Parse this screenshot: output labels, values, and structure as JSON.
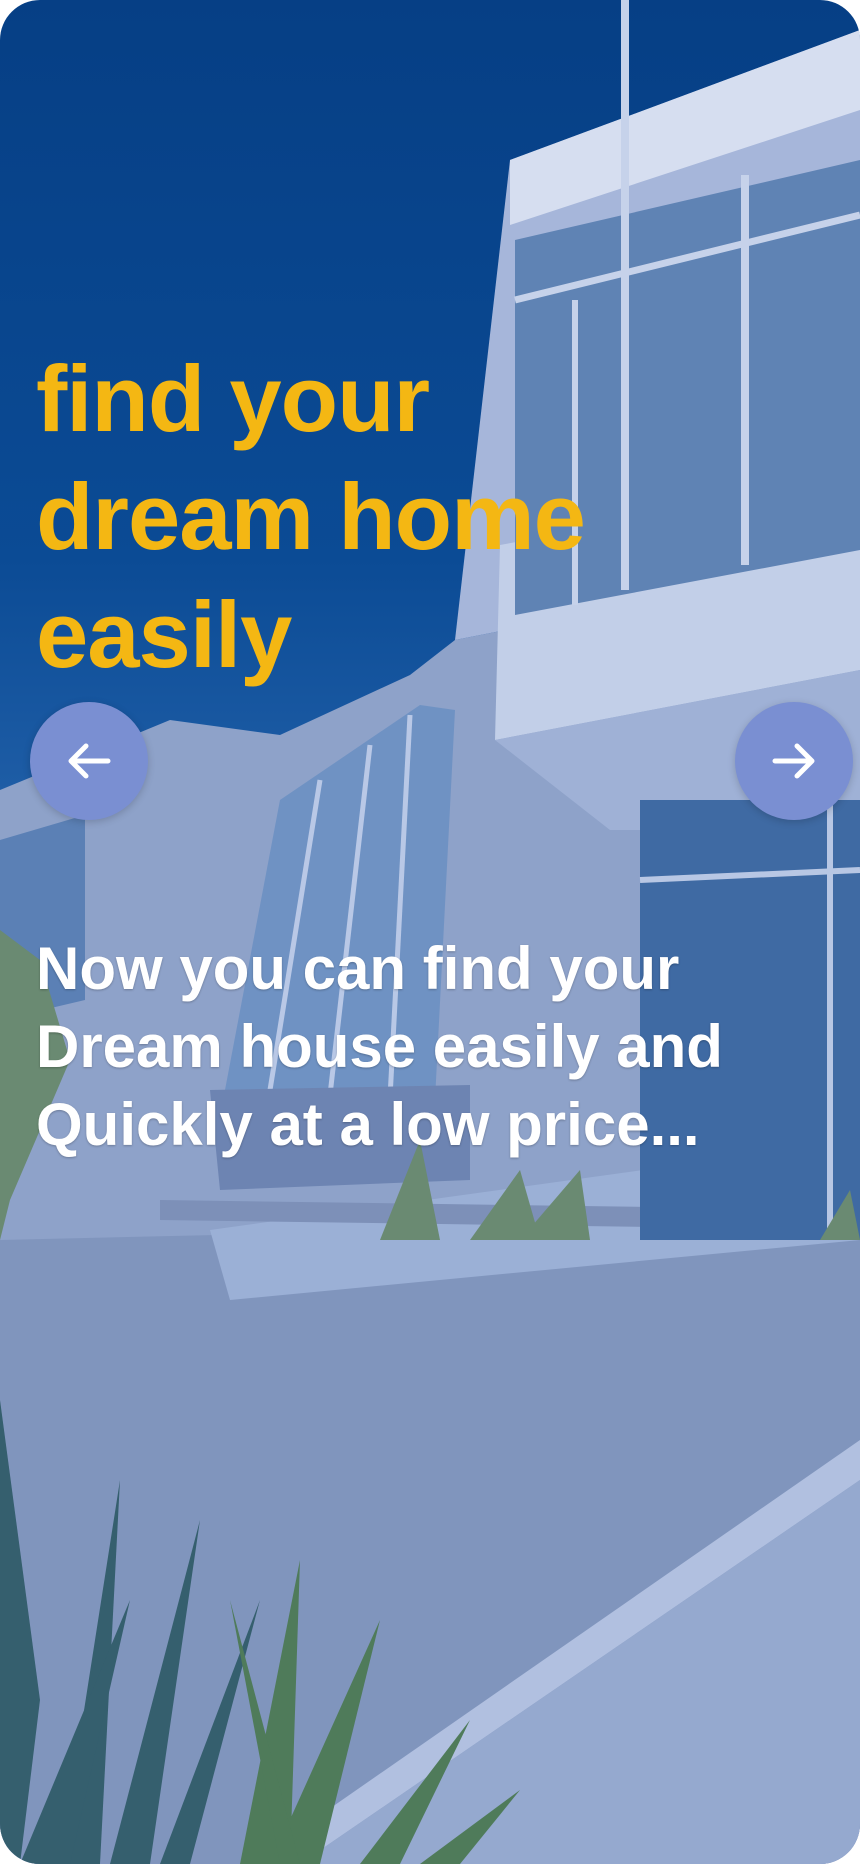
{
  "onboarding": {
    "headline_lines": [
      "find your",
      "dream home",
      "easily"
    ],
    "subtitle_lines": [
      "Now you can find your",
      "Dream house easily and",
      "Quickly at a low price..."
    ]
  },
  "navigation": {
    "prev_icon": "arrow-left-icon",
    "next_icon": "arrow-right-icon"
  },
  "colors": {
    "headline": "#f4b713",
    "subtitle": "#ffffff",
    "nav_button": "#7a8fd2",
    "sky": "#063f85"
  }
}
